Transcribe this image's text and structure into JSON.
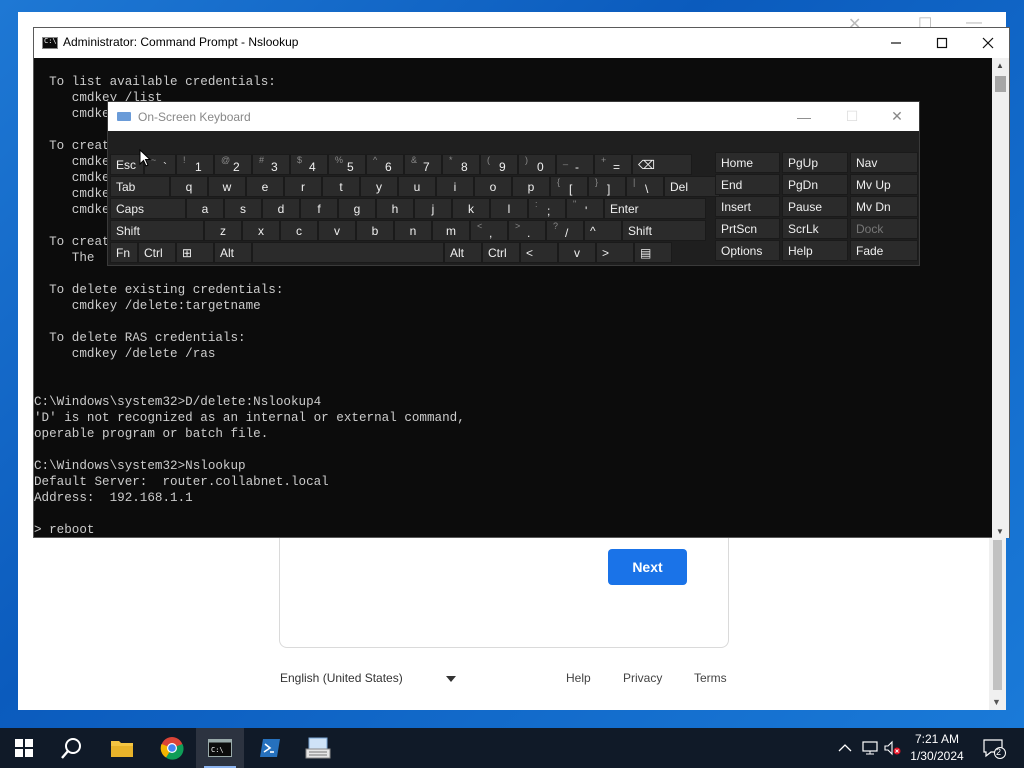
{
  "browser": {
    "next_label": "Next",
    "language": "English (United States)",
    "links": [
      "Help",
      "Privacy",
      "Terms"
    ]
  },
  "cmd": {
    "title": "Administrator: Command Prompt - Nslookup",
    "lines": [
      "  To list available credentials:",
      "     cmdkey /list",
      "     cmdkey /list:targetname",
      "",
      "  To create",
      "     cmdkey",
      "     cmdkey",
      "     cmdkey",
      "     cmdkey",
      "",
      "  To create",
      "     The",
      "",
      "  To delete existing credentials:",
      "     cmdkey /delete:targetname",
      "",
      "  To delete RAS credentials:",
      "     cmdkey /delete /ras",
      "",
      "",
      "C:\\Windows\\system32>D/delete:Nslookup4",
      "'D' is not recognized as an internal or external command,",
      "operable program or batch file.",
      "",
      "C:\\Windows\\system32>Nslookup",
      "Default Server:  router.collabnet.local",
      "Address:  192.168.1.1",
      "",
      "> reboot"
    ]
  },
  "osk": {
    "title": "On-Screen Keyboard",
    "rows": [
      [
        {
          "label": "Esc"
        },
        {
          "sub": "~",
          "main": "`"
        },
        {
          "sub": "!",
          "main": "1"
        },
        {
          "sub": "@",
          "main": "2"
        },
        {
          "sub": "#",
          "main": "3"
        },
        {
          "sub": "$",
          "main": "4"
        },
        {
          "sub": "%",
          "main": "5"
        },
        {
          "sub": "^",
          "main": "6"
        },
        {
          "sub": "&",
          "main": "7"
        },
        {
          "sub": "*",
          "main": "8"
        },
        {
          "sub": "(",
          "main": "9"
        },
        {
          "sub": ")",
          "main": "0"
        },
        {
          "sub": "_",
          "main": "-"
        },
        {
          "sub": "+",
          "main": "="
        },
        {
          "label": "⌫"
        }
      ],
      [
        {
          "label": "Tab"
        },
        {
          "label": "q"
        },
        {
          "label": "w"
        },
        {
          "label": "e"
        },
        {
          "label": "r"
        },
        {
          "label": "t"
        },
        {
          "label": "y"
        },
        {
          "label": "u"
        },
        {
          "label": "i"
        },
        {
          "label": "o"
        },
        {
          "label": "p"
        },
        {
          "sub": "{",
          "main": "["
        },
        {
          "sub": "}",
          "main": "]"
        },
        {
          "sub": "|",
          "main": "\\"
        },
        {
          "label": "Del"
        }
      ],
      [
        {
          "label": "Caps"
        },
        {
          "label": "a"
        },
        {
          "label": "s"
        },
        {
          "label": "d"
        },
        {
          "label": "f"
        },
        {
          "label": "g"
        },
        {
          "label": "h"
        },
        {
          "label": "j"
        },
        {
          "label": "k"
        },
        {
          "label": "l"
        },
        {
          "sub": ":",
          "main": ";"
        },
        {
          "sub": "\"",
          "main": "'"
        },
        {
          "label": "Enter"
        }
      ],
      [
        {
          "label": "Shift"
        },
        {
          "label": "z"
        },
        {
          "label": "x"
        },
        {
          "label": "c"
        },
        {
          "label": "v"
        },
        {
          "label": "b"
        },
        {
          "label": "n"
        },
        {
          "label": "m"
        },
        {
          "sub": "<",
          "main": ","
        },
        {
          "sub": ">",
          "main": "."
        },
        {
          "sub": "?",
          "main": "/"
        },
        {
          "label": "^"
        },
        {
          "label": "Shift"
        }
      ],
      [
        {
          "label": "Fn"
        },
        {
          "label": "Ctrl"
        },
        {
          "label": "⊞"
        },
        {
          "label": "Alt"
        },
        {
          "label": ""
        },
        {
          "label": "Alt"
        },
        {
          "label": "Ctrl"
        },
        {
          "label": "<"
        },
        {
          "label": "v"
        },
        {
          "label": ">"
        },
        {
          "label": "▤"
        }
      ]
    ],
    "nav_rows": [
      [
        "Home",
        "PgUp",
        "Nav"
      ],
      [
        "End",
        "PgDn",
        "Mv Up"
      ],
      [
        "Insert",
        "Pause",
        "Mv Dn"
      ],
      [
        "PrtScn",
        "ScrLk",
        "Dock"
      ],
      [
        "Options",
        "Help",
        "Fade"
      ]
    ]
  },
  "taskbar": {
    "time": "7:21 AM",
    "date": "1/30/2024",
    "notification_count": "2"
  }
}
